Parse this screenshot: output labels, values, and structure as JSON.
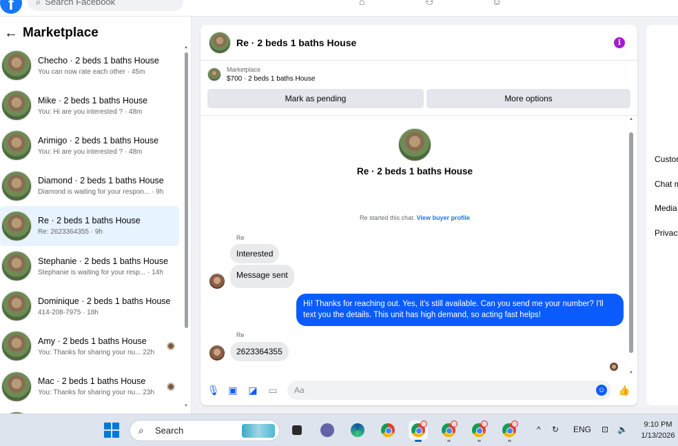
{
  "topbar": {
    "search_placeholder": "Search Facebook",
    "logo_letter": "f"
  },
  "left": {
    "title": "Marketplace",
    "conversations": [
      {
        "name": "Checho · 2 beds 1 baths House",
        "preview": "You can now rate each other · 45m"
      },
      {
        "name": "Mike · 2 beds 1 baths House",
        "preview": "You: Hi are you interested ? · 48m"
      },
      {
        "name": "Arimigo · 2 beds 1 baths House",
        "preview": "You: Hi are you interested ? · 48m"
      },
      {
        "name": "Diamond · 2 beds 1 baths House",
        "preview": "Diamond is waiting for your respon... · 9h"
      },
      {
        "name": "Re · 2 beds 1 baths House",
        "preview": "Re: 2623364355 · 9h"
      },
      {
        "name": "Stephanie · 2 beds 1 baths House",
        "preview": "Stephanie is waiting for your resp... · 14h"
      },
      {
        "name": "Dominique · 2 beds 1 baths House",
        "preview": "414-208-7975 · 18h"
      },
      {
        "name": "Amy · 2 beds 1 baths House",
        "preview": "You: Thanks for sharing your nu... 22h"
      },
      {
        "name": "Mac · 2 beds 1 baths House",
        "preview": "You: Thanks for sharing your nu... 23h"
      }
    ]
  },
  "chat": {
    "title": "Re · 2 beds 1 baths House",
    "listing_label": "Marketplace",
    "listing_price": "$700 · 2 beds 1 baths House",
    "mark_pending": "Mark as pending",
    "more_options": "More options",
    "center_title": "Re · 2 beds 1 baths House",
    "started_text": "Re started this chat.",
    "buyer_profile_link": "View buyer profile",
    "sender_1": "Re",
    "msg_1": "Interested",
    "msg_2": "Message sent",
    "msg_out": "Hi! Thanks for reaching out. Yes, it's still available. Can you send me your number? I'll text you the details. This unit has high demand, so acting fast helps!",
    "sender_2": "Re",
    "msg_3": "2623364355",
    "composer_placeholder": "Aa",
    "info_icon": "i"
  },
  "right": {
    "items": [
      "Custom",
      "Chat m",
      "Media",
      "Privacy"
    ]
  },
  "taskbar": {
    "search_label": "Search",
    "lang": "ENG",
    "time": "9:10 PM",
    "date": "1/13/2026"
  },
  "colors": {
    "accent": "#1877f2",
    "outgoing_bubble": "#0b5cff",
    "incoming_bubble": "#e9eaeb",
    "info_icon": "#a01ec9"
  },
  "icons": [
    "facebook-logo-icon",
    "search-icon",
    "home-icon",
    "friends-icon",
    "profile-icon",
    "back-arrow-icon",
    "info-icon",
    "microphone-icon",
    "image-icon",
    "sticker-icon",
    "gif-icon",
    "emoji-icon",
    "like-icon",
    "windows-start-icon",
    "chrome-icon",
    "edge-icon",
    "teams-icon",
    "wifi-icon",
    "volume-icon"
  ]
}
